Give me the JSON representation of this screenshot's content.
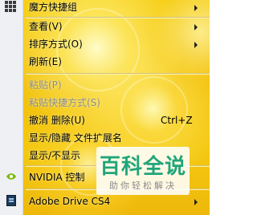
{
  "menu": {
    "items": [
      {
        "label": "魔方快捷组",
        "submenu": true
      },
      {
        "label": "查看(V)",
        "submenu": true
      },
      {
        "label": "排序方式(O)",
        "submenu": true
      },
      {
        "label": "刷新(E)"
      },
      {
        "label": "粘贴(P)",
        "disabled": true
      },
      {
        "label": "粘贴快捷方式(S)",
        "disabled": true
      },
      {
        "label": "撤消 删除(U)",
        "shortcut": "Ctrl+Z"
      },
      {
        "label": "显示/隐藏 文件扩展名"
      },
      {
        "label": "显示/不显示"
      },
      {
        "label": "NVIDIA 控制"
      },
      {
        "label": "Adobe Drive CS4",
        "submenu": true
      }
    ]
  },
  "watermark": {
    "title": "百科全说",
    "subtitle": "助你轻松解决"
  },
  "colors": {
    "background": "#f4c812",
    "watermark_green": "#21a57a",
    "nvidia_green": "#76b900"
  }
}
